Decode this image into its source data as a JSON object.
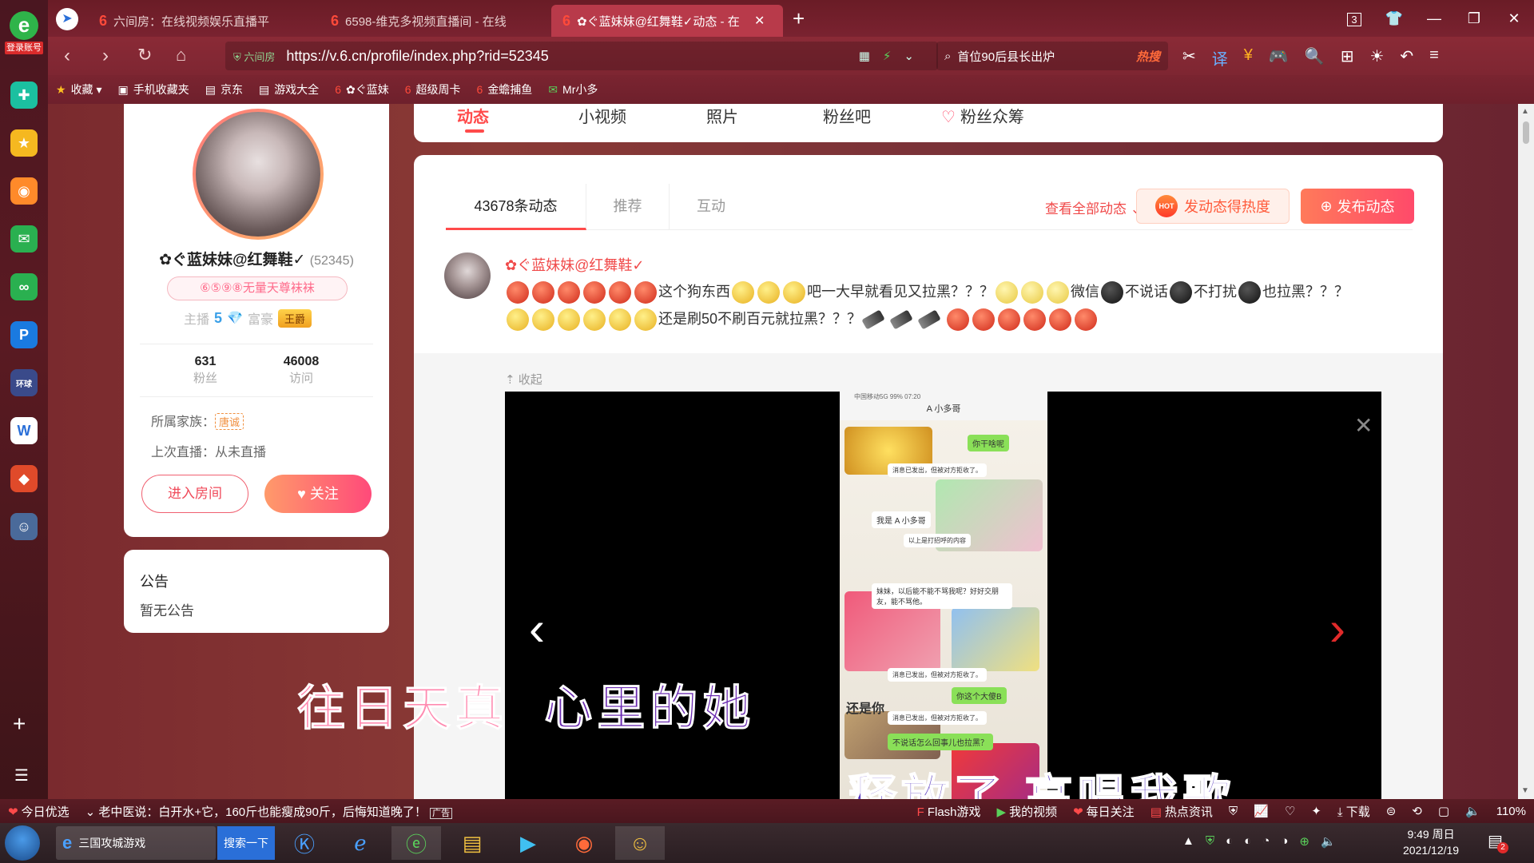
{
  "sidebar": {
    "login_label": "登录账号",
    "apps": [
      "qq-browser-icon",
      "favorite-star-icon",
      "weibo-icon",
      "mail-icon",
      "game-icon",
      "pp-icon",
      "finance-icon",
      "word-doc-icon",
      "game-app-icon",
      "game-character-icon"
    ]
  },
  "tabs": [
    {
      "label": "六间房：在线视频娱乐直播平"
    },
    {
      "label": "6598-维克多视频直播间 - 在线"
    },
    {
      "label": "✿ぐ蓝妹妹@红舞鞋✓动态 - 在"
    }
  ],
  "window": {
    "tab_count": "3"
  },
  "address": {
    "host_hint": "六间房",
    "url": "https://v.6.cn/profile/index.php?rid=52345",
    "search_text": "首位90后县长出炉",
    "search_badge": "热搜"
  },
  "bookmarks": [
    "收藏",
    "手机收藏夹",
    "京东",
    "游戏大全",
    "✿ぐ蓝妹",
    "超级周卡",
    "金蟾捕鱼",
    "Mr小多"
  ],
  "profile": {
    "name": "✿ぐ蓝妹妹@红舞鞋✓",
    "rid": "(52345)",
    "tag": "⑥⑤⑨⑧无量天尊袜袜",
    "anchor_label": "主播",
    "anchor_level": "5",
    "rich_label": "富豪",
    "rich_badge": "王爵",
    "fans_count": "631",
    "fans_label": "粉丝",
    "visits_count": "46008",
    "visits_label": "访问",
    "family_label": "所属家族：",
    "family_tag": "唐诚",
    "last_live": "上次直播：从未直播",
    "enter_room": "进入房间",
    "follow": "关注"
  },
  "notice": {
    "title": "公告",
    "content": "暂无公告"
  },
  "profile_tabs": [
    "动态",
    "小视频",
    "照片",
    "粉丝吧",
    "粉丝众筹"
  ],
  "feed": {
    "tabs": [
      "43678条动态",
      "推荐",
      "互动"
    ],
    "view_all": "查看全部动态",
    "heat_button": "发动态得热度",
    "hot_badge": "HOT",
    "post_button": "发布动态",
    "post": {
      "author": "✿ぐ蓝妹妹@红舞鞋✓",
      "text_1": "这个狗东西",
      "text_2": "吧一大早就看见又拉黑？？？",
      "text_3": "微信",
      "text_4": "不说话",
      "text_5": "不打扰",
      "text_6": "也拉黑？？？",
      "text_7": "还是刷50不刷百元就拉黑？？？",
      "collapse": "收起"
    },
    "image": {
      "chat_title": "A 小多哥",
      "status": "中国移动5G  99% 07:20",
      "bubbles": [
        "你干啥呢",
        "消息已发出，但被对方拒收了。",
        "我是 A 小多哥",
        "以上是打招呼的内容",
        "妹妹，以后能不能不骂我呢？好好交朋友，能不骂他。",
        "消息已发出，但被对方拒收了。",
        "你这个大傻B",
        "消息已发出，但被对方拒收了。",
        "不说话怎么回事儿也拉黑？",
        "还是你"
      ]
    }
  },
  "lyrics": {
    "line1_a": "往日天真",
    "line1_b": "心里的她",
    "line2": "释放了 高唱我歌"
  },
  "statusbar": {
    "left": "今日优选",
    "news": "老中医说：白开水+它，160斤也能瘦成90斤，后悔知道晚了！",
    "ad": "广告",
    "items": [
      "Flash游戏",
      "我的视频",
      "每日关注",
      "热点资讯",
      "下载"
    ],
    "zoom": "110%"
  },
  "taskbar": {
    "window_title": "三国攻城游戏",
    "search_button": "搜索一下",
    "time": "9:49 周日",
    "date": "2021/12/19",
    "notif_count": "2"
  }
}
